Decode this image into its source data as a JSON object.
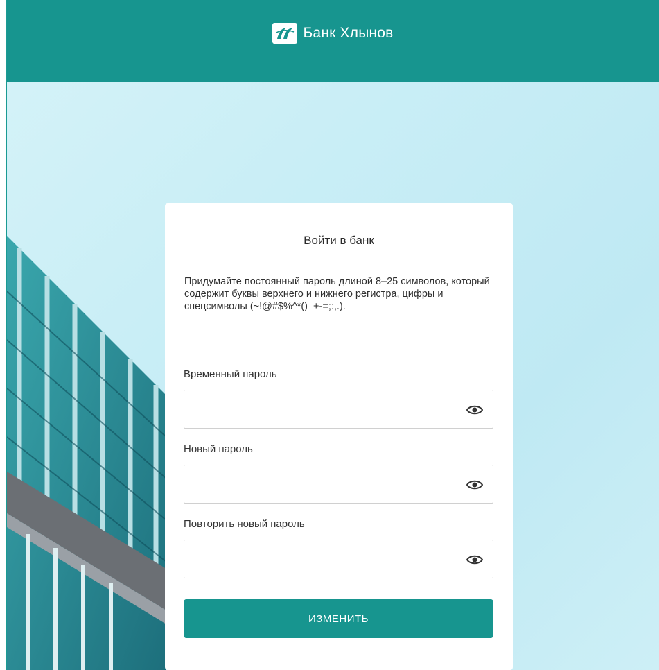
{
  "header": {
    "bank_name": "Банк Хлынов",
    "bg_color": "#17958f"
  },
  "card": {
    "title": "Войти в банк",
    "hint": "Придумайте постоянный пароль длиной 8–25 символов, который содержит буквы верхнего и нижнего регистра, цифры и спецсимволы (~!@#$%^*()_+-=;:,.).",
    "fields": [
      {
        "label": "Временный пароль",
        "value": "",
        "icon": "eye-icon"
      },
      {
        "label": "Новый пароль",
        "value": "",
        "icon": "eye-icon"
      },
      {
        "label": "Повторить новый пароль",
        "value": "",
        "icon": "eye-icon"
      }
    ],
    "submit_label": "ИЗМЕНИТЬ",
    "accent_color": "#17958f"
  }
}
